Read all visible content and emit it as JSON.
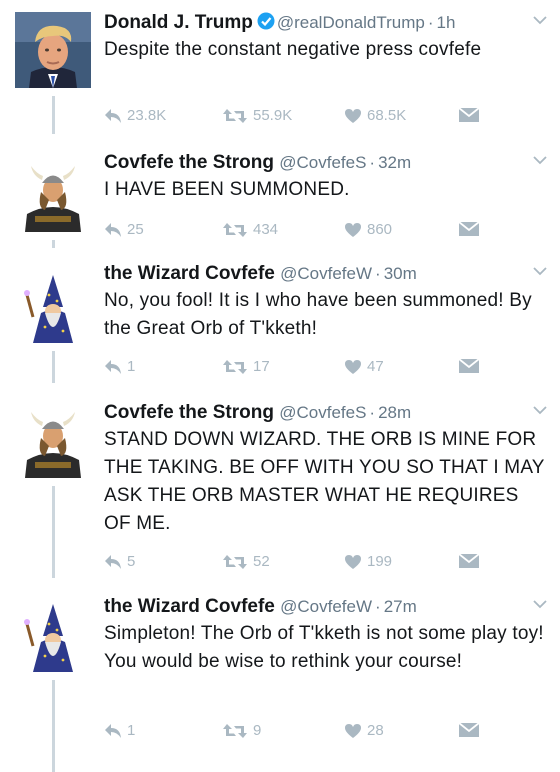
{
  "tweets": [
    {
      "name": "Donald J. Trump",
      "handle": "@realDonaldTrump",
      "separator": "·",
      "time": "1h",
      "verified": true,
      "avatar": "trump-portrait",
      "text": "Despite the constant negative press covfefe",
      "replies": "23.8K",
      "retweets": "55.9K",
      "likes": "68.5K"
    },
    {
      "name": "Covfefe the Strong",
      "handle": "@CovfefeS",
      "separator": "·",
      "time": "32m",
      "avatar": "viking-warrior",
      "text": "I HAVE BEEN SUMMONED.",
      "replies": "25",
      "retweets": "434",
      "likes": "860"
    },
    {
      "name": "the Wizard Covfefe",
      "handle": "@CovfefeW",
      "separator": "·",
      "time": "30m",
      "avatar": "wizard",
      "text": "No, you fool! It is I who have been summoned! By the Great Orb of T'kketh!",
      "replies": "1",
      "retweets": "17",
      "likes": "47"
    },
    {
      "name": "Covfefe the Strong",
      "handle": "@CovfefeS",
      "separator": "·",
      "time": "28m",
      "avatar": "viking-warrior",
      "text": "STAND DOWN WIZARD. THE ORB IS MINE FOR THE TAKING. BE OFF WITH YOU SO THAT I MAY ASK THE ORB MASTER WHAT HE REQUIRES OF ME.",
      "replies": "5",
      "retweets": "52",
      "likes": "199"
    },
    {
      "name": "the Wizard Covfefe",
      "handle": "@CovfefeW",
      "separator": "·",
      "time": "27m",
      "avatar": "wizard",
      "text": "Simpleton! The Orb of T'kketh is not some play toy! You would be wise to rethink your course!",
      "replies": "1",
      "retweets": "9",
      "likes": "28"
    }
  ],
  "colors": {
    "verified": "#1da1f2",
    "muted_icon": "#aab8c2",
    "secondary_text": "#657786",
    "thread_line": "#ccd6dd"
  }
}
